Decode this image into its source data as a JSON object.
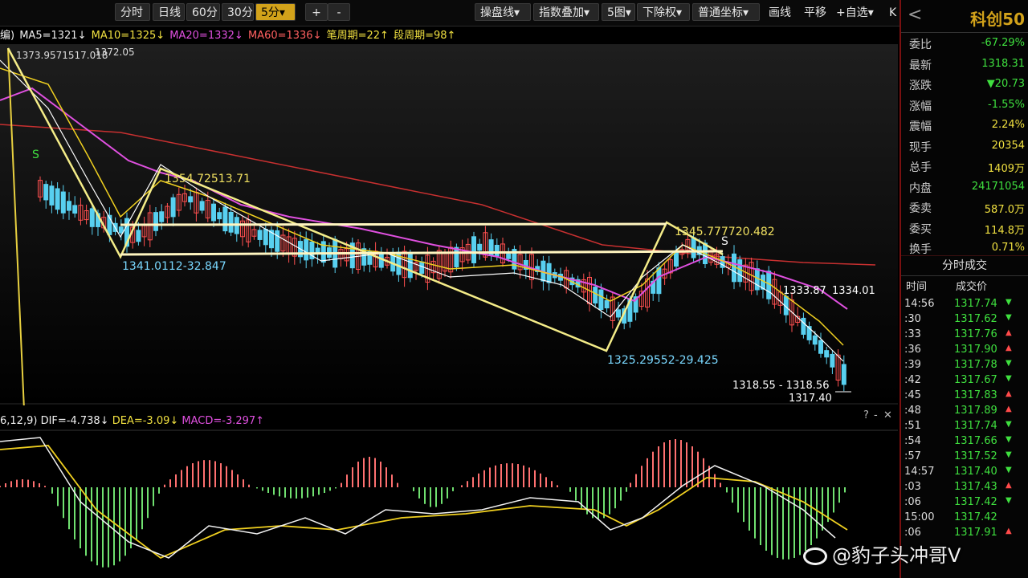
{
  "toolbar": {
    "left_buttons": [
      "分时",
      "日线",
      "60分",
      "30分",
      "5分▾"
    ],
    "active_index": 4,
    "zoom_buttons": [
      "+",
      "-"
    ],
    "right_buttons": [
      "操盘线▾",
      "指数叠加▾",
      "5图▾",
      "下除权▾",
      "普通坐标▾",
      "画线",
      "平移",
      "+自选▾",
      "K"
    ]
  },
  "legend": {
    "prefix": "编)",
    "ma5": "MA5=1321↓",
    "ma10": "MA10=1325↓",
    "ma20": "MA20=1332↓",
    "ma60": "MA60=1336↓",
    "bi": "笔周期=22↑",
    "duan": "段周期=98↑"
  },
  "main_chart": {
    "annotations": {
      "top_left": "1373.9571517.018",
      "top_left2": "1372.05",
      "s_marker": "S",
      "peak1": "1354.72513.71",
      "low1": "1341.0112-32.847",
      "peak2": "1345.777720.482",
      "low2": "1325.29552-29.425",
      "mid_right_1": "1333.87",
      "mid_right_2": "1334.01",
      "last_range": "1318.55 - 1318.56",
      "last": "1317.40"
    }
  },
  "sub_legend": {
    "prefix": "6,12,9)",
    "dif": "DIF=-4.738↓",
    "dea": "DEA=-3.09↓",
    "macd": "MACD=-3.297↑"
  },
  "sub_controls": [
    "?",
    "-",
    "✕"
  ],
  "right_panel": {
    "back": "<",
    "title": "科创50",
    "stats": [
      {
        "k": "委比",
        "v": "-67.29%",
        "c": "green"
      },
      {
        "k": "最新",
        "v": "1318.31",
        "c": "green"
      },
      {
        "k": "涨跌",
        "v": "▼20.73",
        "c": "green"
      },
      {
        "k": "涨幅",
        "v": "-1.55%",
        "c": "green"
      },
      {
        "k": "震幅",
        "v": "2.24%",
        "c": "yellow"
      },
      {
        "k": "现手",
        "v": "20354",
        "c": "yellow"
      },
      {
        "k": "总手",
        "v": "1409万",
        "c": "yellow"
      },
      {
        "k": "内盘",
        "v": "24171054",
        "c": "green"
      },
      {
        "k": "委卖",
        "v": "587.0万",
        "c": "yellow"
      },
      {
        "k": "委买",
        "v": "114.8万",
        "c": "yellow"
      },
      {
        "k": "换手",
        "v": "0.71%",
        "c": "yellow"
      }
    ],
    "ticks_title": "分时成交",
    "col_time": "时间",
    "col_price": "成交价",
    "ticks": [
      {
        "t": "14:56",
        "p": "1317.74",
        "d": "▼",
        "c": "green"
      },
      {
        "t": ":30",
        "p": "1317.62",
        "d": "▼",
        "c": "green"
      },
      {
        "t": ":33",
        "p": "1317.76",
        "d": "▲",
        "c": "green"
      },
      {
        "t": ":36",
        "p": "1317.90",
        "d": "▲",
        "c": "green"
      },
      {
        "t": ":39",
        "p": "1317.78",
        "d": "▼",
        "c": "green"
      },
      {
        "t": ":42",
        "p": "1317.67",
        "d": "▼",
        "c": "green"
      },
      {
        "t": ":45",
        "p": "1317.83",
        "d": "▲",
        "c": "green"
      },
      {
        "t": ":48",
        "p": "1317.89",
        "d": "▲",
        "c": "green"
      },
      {
        "t": ":51",
        "p": "1317.74",
        "d": "▼",
        "c": "green"
      },
      {
        "t": ":54",
        "p": "1317.66",
        "d": "▼",
        "c": "green"
      },
      {
        "t": ":57",
        "p": "1317.52",
        "d": "▼",
        "c": "green"
      },
      {
        "t": "14:57",
        "p": "1317.40",
        "d": "▼",
        "c": "green"
      },
      {
        "t": ":03",
        "p": "1317.43",
        "d": "▲",
        "c": "green"
      },
      {
        "t": ":06",
        "p": "1317.42",
        "d": "▼",
        "c": "green"
      },
      {
        "t": "15:00",
        "p": "1317.42",
        "d": "",
        "c": "green"
      },
      {
        "t": ":06",
        "p": "1317.91",
        "d": "▲",
        "c": "green"
      }
    ]
  },
  "watermark": "@豹子头冲哥V",
  "colors": {
    "up": "#ff4a4a",
    "down": "#3fe03f",
    "ma5": "#ffffff",
    "ma10": "#f0d020",
    "ma20": "#e050e0",
    "ma60": "#c03030",
    "bi": "#f0e070"
  }
}
